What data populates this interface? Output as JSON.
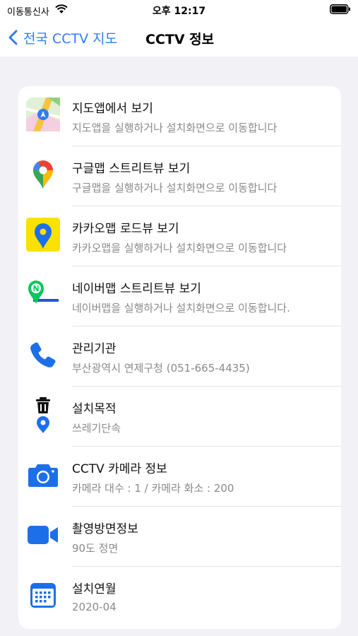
{
  "status_bar": {
    "carrier": "이동통신사",
    "time": "오후 12:17"
  },
  "nav": {
    "back_label": "전국 CCTV 지도",
    "title": "CCTV 정보"
  },
  "colors": {
    "accent": "#2f7bf6",
    "icon_blue": "#1c6fe8",
    "kakao_yellow": "#fae100",
    "background": "#f2f2f6"
  },
  "rows": [
    {
      "icon": "apple-maps-icon",
      "title": "지도앱에서 보기",
      "subtitle": "지도앱을 실행하거나 설치화면으로 이동합니다"
    },
    {
      "icon": "google-maps-icon",
      "title": "구글맵 스트리트뷰 보기",
      "subtitle": "구글맵을 실행하거나 설치화면으로 이동합니다"
    },
    {
      "icon": "kakao-map-icon",
      "title": "카카오맵 로드뷰 보기",
      "subtitle": "카카오맵을 실행하거나 설치화면으로 이동합니다"
    },
    {
      "icon": "naver-map-icon",
      "title": "네이버맵 스트리트뷰 보기",
      "subtitle": "네이버맵을 실행하거나 설치화면으로 이동합니다."
    },
    {
      "icon": "phone-icon",
      "title": "관리기관",
      "subtitle": "부산광역시 연제구청 (051-665-4435)"
    },
    {
      "icon": "trash-location-icon",
      "title": "설치목적",
      "subtitle": "쓰레기단속"
    },
    {
      "icon": "camera-icon",
      "title": "CCTV 카메라 정보",
      "subtitle": "카메라 대수 : 1 / 카메라 화소 : 200"
    },
    {
      "icon": "video-camera-icon",
      "title": "촬영방면정보",
      "subtitle": "90도 정면"
    },
    {
      "icon": "calendar-icon",
      "title": "설치연월",
      "subtitle": "2020-04"
    }
  ]
}
